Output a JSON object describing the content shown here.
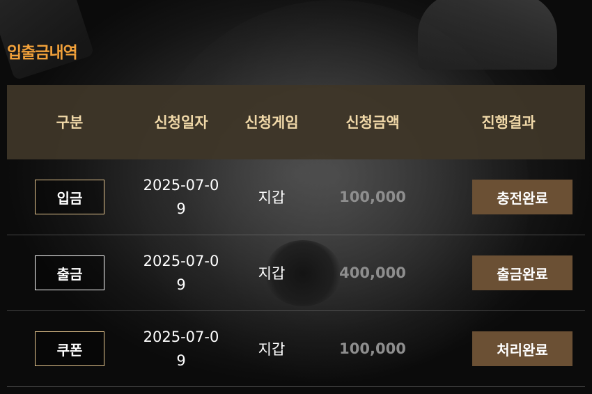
{
  "page": {
    "title": "입출금내역"
  },
  "table": {
    "headers": [
      "구분",
      "신청일자",
      "신청게임",
      "신청금액",
      "진행결과"
    ],
    "rows": [
      {
        "type": "입금",
        "date": "2025-07-09",
        "game": "지갑",
        "amount": "100,000",
        "status": "충전완료"
      },
      {
        "type": "출금",
        "date": "2025-07-09",
        "game": "지갑",
        "amount": "400,000",
        "status": "출금완료"
      },
      {
        "type": "쿠폰",
        "date": "2025-07-09",
        "game": "지갑",
        "amount": "100,000",
        "status": "처리완료"
      }
    ]
  },
  "colors": {
    "title": "#f2a13a",
    "header_bg": "#3e3628",
    "header_text": "#f0d8a8",
    "status_bg": "#6b5034",
    "amount_text": "#8e8e8e",
    "badge_border_deposit": "#e8c890",
    "badge_border_withdraw": "#ffffff"
  }
}
